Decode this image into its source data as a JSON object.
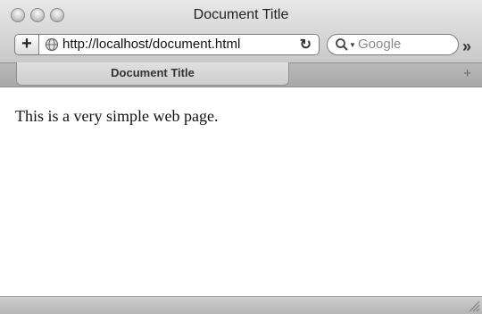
{
  "window": {
    "title": "Document Title"
  },
  "toolbar": {
    "add_button_label": "+",
    "address": "http://localhost/document.html",
    "reload_glyph": "↻",
    "search_placeholder": "Google",
    "overflow_glyph": "»"
  },
  "tabs": [
    {
      "label": "Document Title",
      "active": true
    }
  ],
  "tabbar": {
    "new_tab_glyph": "+"
  },
  "page": {
    "body_text": "This is a very simple web page."
  },
  "icons": {
    "traffic_lights": [
      "close-icon",
      "minimize-icon",
      "zoom-icon"
    ],
    "address_icon": "globe-icon",
    "search_icon": "magnifier-icon",
    "reload_icon": "reload-icon",
    "overflow_icon": "chevron-double-right-icon",
    "resize_icon": "resize-grip-icon"
  }
}
